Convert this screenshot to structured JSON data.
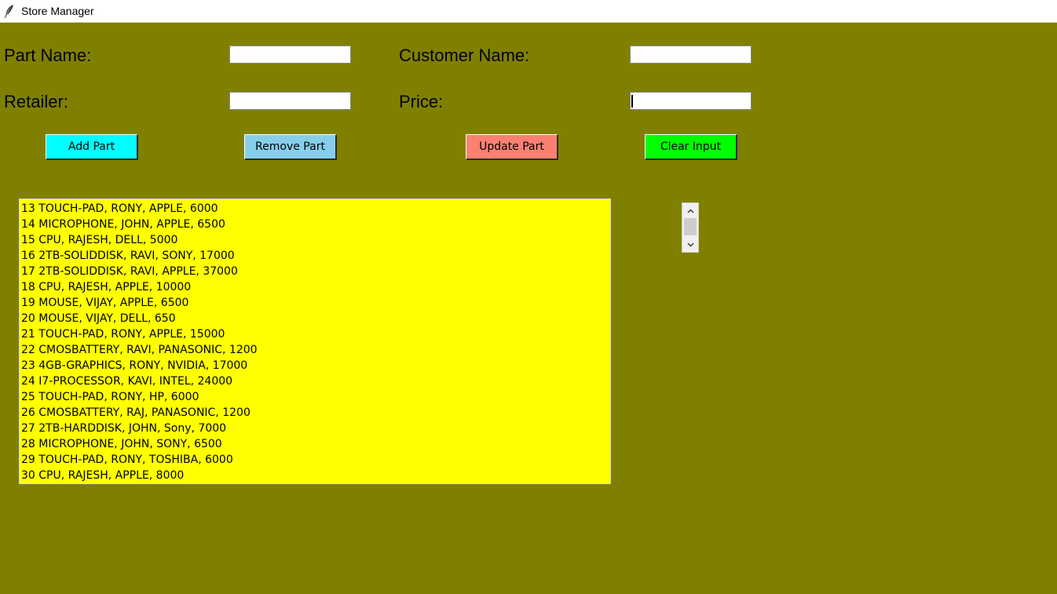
{
  "window": {
    "title": "Store Manager",
    "icon": "feather-icon"
  },
  "form": {
    "part_name_label": "Part Name:",
    "part_name_value": "",
    "customer_name_label": "Customer Name:",
    "customer_name_value": "",
    "retailer_label": "Retailer:",
    "retailer_value": "",
    "price_label": "Price:",
    "price_value": ""
  },
  "buttons": {
    "add": {
      "label": "Add Part",
      "color": "#00ffff"
    },
    "remove": {
      "label": "Remove Part",
      "color": "#87ceeb"
    },
    "update": {
      "label": "Update Part",
      "color": "#fa8072"
    },
    "clear": {
      "label": "Clear Input",
      "color": "#00ff00"
    }
  },
  "colors": {
    "background": "#808000",
    "listbox": "#ffff00"
  },
  "parts_list": [
    "13 TOUCH-PAD, RONY, APPLE, 6000",
    "14 MICROPHONE, JOHN, APPLE, 6500",
    "15 CPU, RAJESH, DELL, 5000",
    "16 2TB-SOLIDDISK, RAVI, SONY, 17000",
    "17 2TB-SOLIDDISK, RAVI, APPLE, 37000",
    "18 CPU, RAJESH, APPLE, 10000",
    "19 MOUSE, VIJAY, APPLE, 6500",
    "20 MOUSE, VIJAY, DELL, 650",
    "21 TOUCH-PAD, RONY, APPLE, 15000",
    "22 CMOSBATTERY, RAVI, PANASONIC, 1200",
    "23 4GB-GRAPHICS, RONY, NVIDIA, 17000",
    "24 I7-PROCESSOR, KAVI, INTEL, 24000",
    "25 TOUCH-PAD, RONY, HP, 6000",
    "26 CMOSBATTERY, RAJ, PANASONIC, 1200",
    "27 2TB-HARDDISK, JOHN, Sony, 7000",
    "28 MICROPHONE, JOHN, SONY, 6500",
    "29 TOUCH-PAD, RONY, TOSHIBA, 6000",
    "30 CPU, RAJESH, APPLE, 8000"
  ]
}
